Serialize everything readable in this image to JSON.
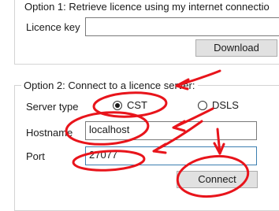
{
  "option1": {
    "legend": "Option 1: Retrieve licence using my internet connectio",
    "licence_key_label": "Licence key",
    "licence_key_value": "",
    "download_button": "Download"
  },
  "option2": {
    "legend": "Option 2: Connect to a licence server:",
    "server_type_label": "Server type",
    "radio_cst": "CST",
    "radio_dsls": "DSLS",
    "selected_server_type": "CST",
    "hostname_label": "Hostname",
    "hostname_value": "localhost",
    "port_label": "Port",
    "port_value": "27077",
    "connect_button": "Connect"
  },
  "colors": {
    "annotation": "#e8141b",
    "focus_border": "#3c7fb1",
    "button_bg": "#e1e1e1",
    "group_border": "#d4d4d4"
  }
}
